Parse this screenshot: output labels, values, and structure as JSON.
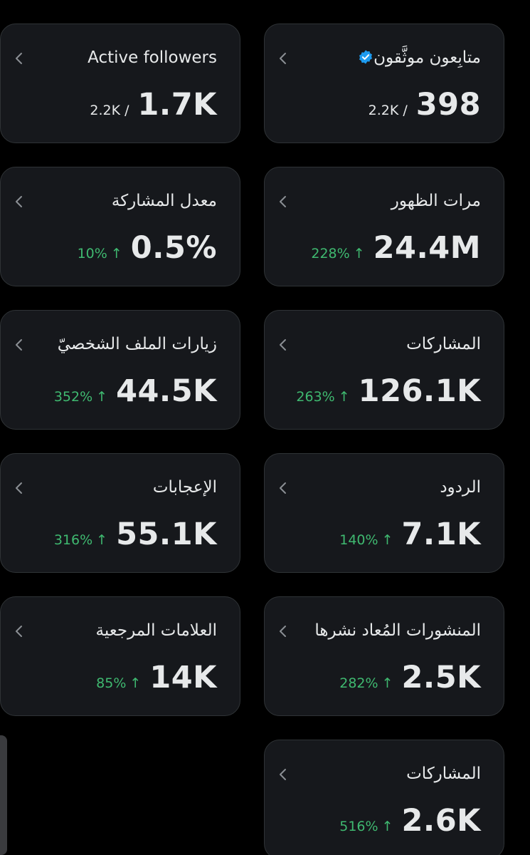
{
  "cards": {
    "verified_followers": {
      "title": "متابِعون موثَّقون",
      "value": "398",
      "sub": "2.2K /"
    },
    "active_followers": {
      "title": "Active followers",
      "value": "1.7K",
      "sub": "2.2K /"
    },
    "impressions": {
      "title": "مرات الظهور",
      "value": "24.4M",
      "delta": "228%",
      "trend": "up"
    },
    "engagement_rate": {
      "title": "معدل المشاركة",
      "value": "0.5%",
      "delta": "10%",
      "trend": "up"
    },
    "engagements": {
      "title": "المشاركات",
      "value": "126.1K",
      "delta": "263%",
      "trend": "up"
    },
    "profile_visits": {
      "title": "زيارات الملف الشخصيّ",
      "value": "44.5K",
      "delta": "352%",
      "trend": "up"
    },
    "replies": {
      "title": "الردود",
      "value": "7.1K",
      "delta": "140%",
      "trend": "up"
    },
    "likes": {
      "title": "الإعجابات",
      "value": "55.1K",
      "delta": "316%",
      "trend": "up"
    },
    "reposts": {
      "title": "المنشورات المُعاد نشرها",
      "value": "2.5K",
      "delta": "282%",
      "trend": "up"
    },
    "bookmarks": {
      "title": "العلامات المرجعية",
      "value": "14K",
      "delta": "85%",
      "trend": "up"
    },
    "shares": {
      "title": "المشاركات",
      "value": "2.6K",
      "delta": "516%",
      "trend": "up"
    }
  },
  "colors": {
    "background": "#000000",
    "card": "#16181c",
    "border": "#2f3336",
    "text": "#e7e9ea",
    "positive": "#3fb970",
    "verified": "#1d9bf0"
  },
  "icons": {
    "chevron": "chevron-left-icon",
    "verified": "verified-badge-icon",
    "trend_up": "arrow-up-icon"
  }
}
